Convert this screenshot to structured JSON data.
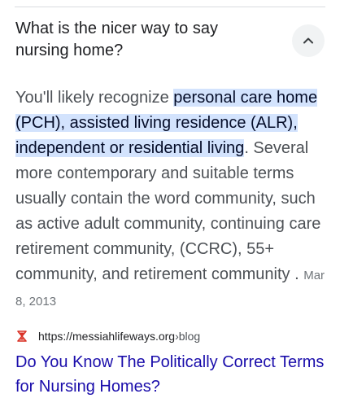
{
  "question": {
    "title": "What is the nicer way to say nursing home?",
    "expanded": true
  },
  "answer": {
    "lead": "You'll likely recognize ",
    "highlight": "personal care home (PCH), assisted living residence (ALR), independent or residential living",
    "after_highlight": ".",
    "rest": " Several more contemporary and suitable terms usually contain the word community, such as active adult community, continuing care retirement community, (CCRC), 55+ community, and retirement community . ",
    "date": "Mar 8, 2013"
  },
  "source": {
    "url": "https://messiahlifeways.org",
    "separator": " › ",
    "path": "blog",
    "favicon": "hourglass-icon",
    "favicon_color": "#d93025"
  },
  "result": {
    "title": "Do You Know The Politically Correct Terms for Nursing Homes?"
  },
  "colors": {
    "link": "#1a0dab",
    "highlight": "#d3e3fd",
    "text": "#4d5156",
    "title": "#202124"
  }
}
